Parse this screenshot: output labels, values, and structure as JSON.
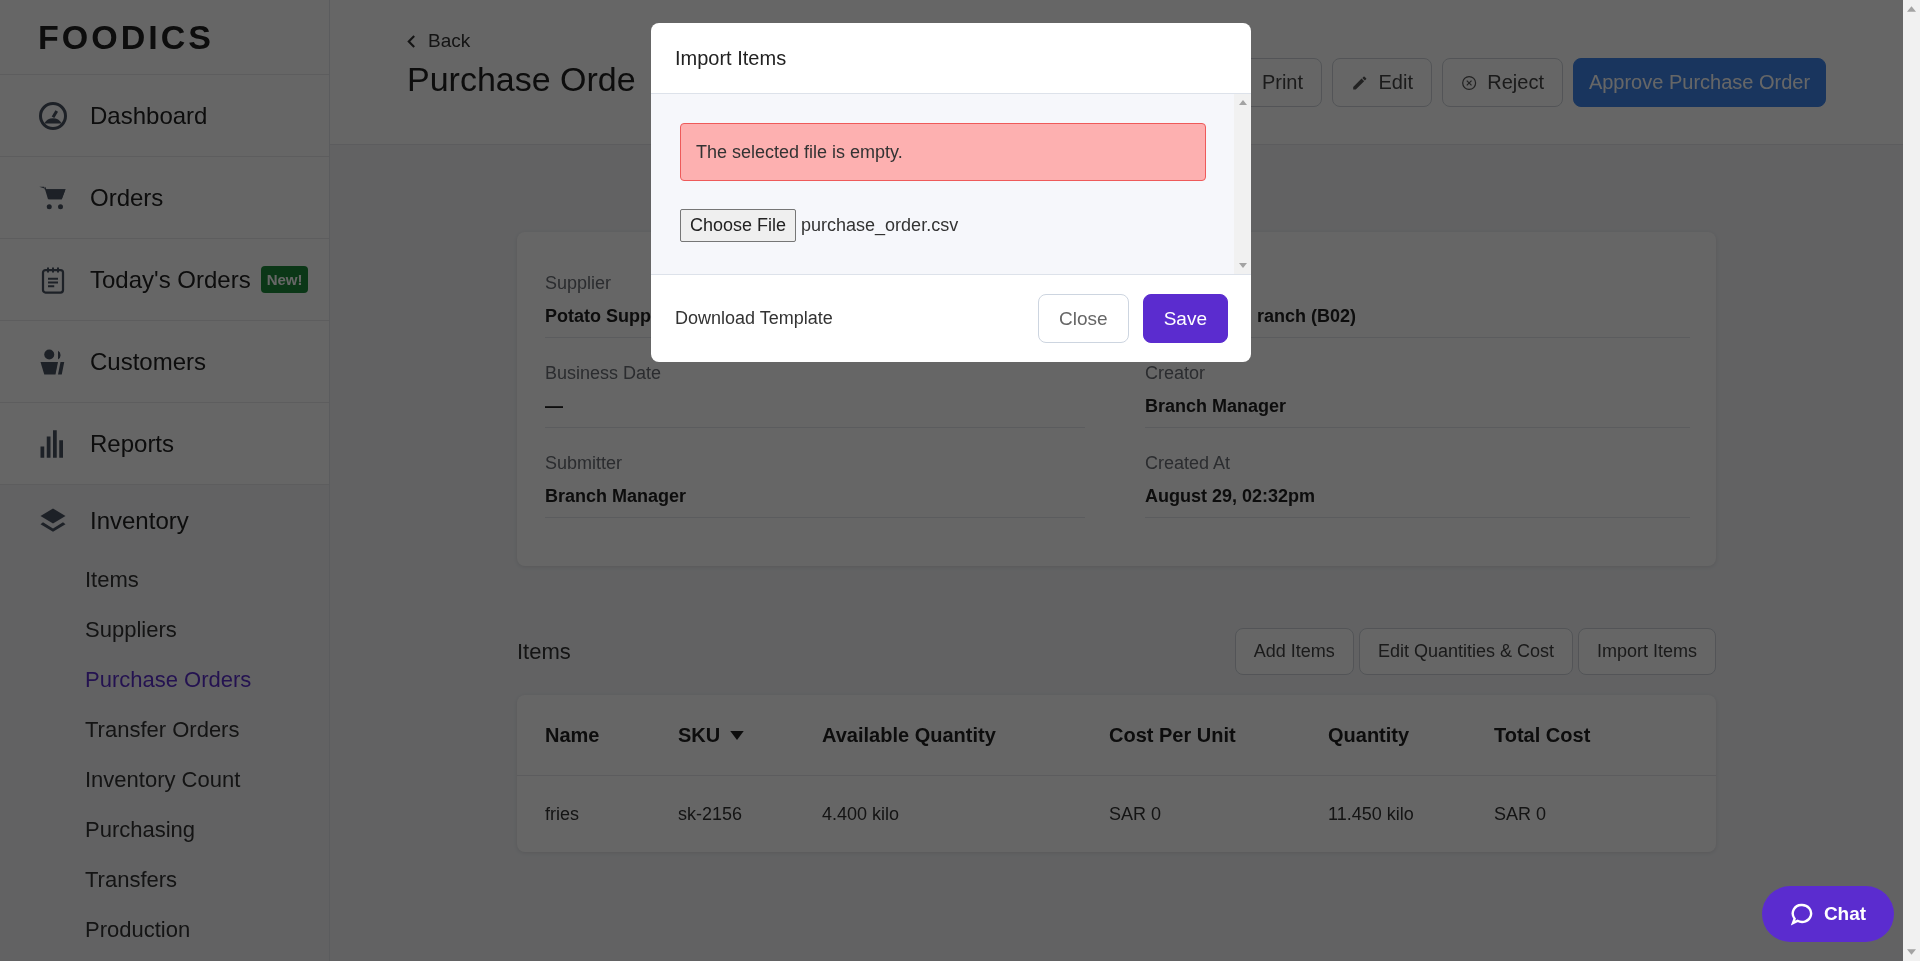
{
  "sidebar": {
    "logo": "FOODICS",
    "nav": [
      {
        "label": "Dashboard"
      },
      {
        "label": "Orders"
      },
      {
        "label": "Today's Orders",
        "badge": "New!"
      },
      {
        "label": "Customers"
      },
      {
        "label": "Reports"
      }
    ],
    "inventory": {
      "label": "Inventory",
      "children": [
        {
          "label": "Items",
          "selected": false
        },
        {
          "label": "Suppliers",
          "selected": false
        },
        {
          "label": "Purchase Orders",
          "selected": true
        },
        {
          "label": "Transfer Orders",
          "selected": false
        },
        {
          "label": "Inventory Count",
          "selected": false
        },
        {
          "label": "Purchasing",
          "selected": false
        },
        {
          "label": "Transfers",
          "selected": false
        },
        {
          "label": "Production",
          "selected": false
        }
      ]
    }
  },
  "header": {
    "back": "Back",
    "title": "Purchase Orde",
    "actions": [
      "Print",
      "Edit",
      "Reject"
    ],
    "primary_action": "Approve Purchase Order"
  },
  "details": {
    "left": [
      {
        "label": "Supplier",
        "value": "Potato Supp"
      },
      {
        "label": "Business Date",
        "value": "—"
      },
      {
        "label": "Submitter",
        "value": "Branch Manager"
      }
    ],
    "right": [
      {
        "value": "ranch (B02)"
      },
      {
        "label": "Creator",
        "value": "Branch Manager"
      },
      {
        "label": "Created At",
        "value": "August 29, 02:32pm"
      }
    ]
  },
  "items": {
    "title": "Items",
    "buttons": [
      "Add Items",
      "Edit Quantities & Cost",
      "Import Items"
    ],
    "columns": [
      {
        "label": "Name",
        "sorted": false
      },
      {
        "label": "SKU",
        "sorted": true
      },
      {
        "label": "Available Quantity",
        "sorted": false
      },
      {
        "label": "Cost Per Unit",
        "sorted": false
      },
      {
        "label": "Quantity",
        "sorted": false
      },
      {
        "label": "Total Cost",
        "sorted": false
      }
    ],
    "rows": [
      [
        "fries",
        "sk-2156",
        "4.400 kilo",
        "SAR 0",
        "11.450 kilo",
        "SAR 0"
      ]
    ]
  },
  "modal": {
    "title": "Import Items",
    "alert": "The selected file is empty.",
    "file_button": "Choose File",
    "file_name": "purchase_order.csv",
    "download_link": "Download Template",
    "buttons": [
      "Close",
      "Save"
    ]
  },
  "chat": {
    "label": "Chat"
  }
}
